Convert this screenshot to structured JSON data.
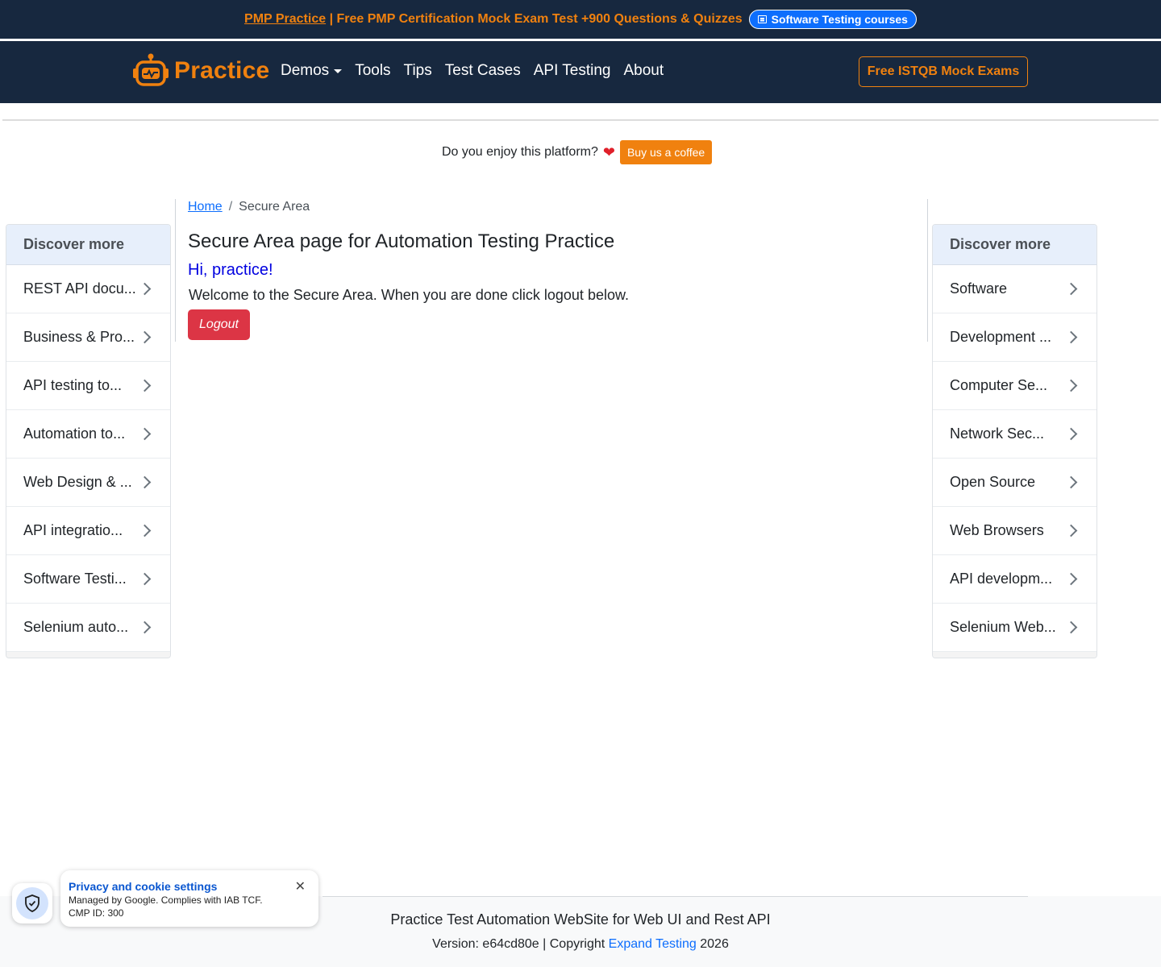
{
  "topbar": {
    "promo_link": "PMP Practice",
    "promo_text": " | Free PMP Certification Mock Exam Test +900 Questions & Quizzes",
    "pill_label": "Software Testing courses"
  },
  "navbar": {
    "brand": "Practice",
    "links": [
      "Demos",
      "Tools",
      "Tips",
      "Test Cases",
      "API Testing",
      "About"
    ],
    "cta": "Free ISTQB Mock Exams"
  },
  "coffee": {
    "question": "Do you enjoy this platform?",
    "button": "Buy us a coffee"
  },
  "breadcrumb": {
    "home": "Home",
    "current": "Secure Area"
  },
  "main": {
    "title": "Secure Area page for Automation Testing Practice",
    "greeting": "Hi, practice!",
    "welcome": "Welcome to the Secure Area. When you are done click logout below.",
    "logout_label": "Logout"
  },
  "left_sidebar": {
    "heading": "Discover more",
    "items": [
      "REST API docu...",
      "Business & Pro...",
      "API testing to...",
      "Automation to...",
      "Web Design & ...",
      "API integratio...",
      "Software Testi...",
      "Selenium auto..."
    ]
  },
  "right_sidebar": {
    "heading": "Discover more",
    "items": [
      "Software",
      "Development ...",
      "Computer Se...",
      "Network Sec...",
      "Open Source",
      "Web Browsers",
      "API developm...",
      "Selenium Web..."
    ]
  },
  "footer": {
    "title": "Practice Test Automation WebSite for Web UI and Rest API",
    "version_prefix": "Version: e64cd80e | Copyright ",
    "company": "Expand Testing",
    "year": " 2026"
  },
  "cookie": {
    "title": "Privacy and cookie settings",
    "line1": "Managed by Google. Complies with IAB TCF.",
    "line2": "CMP ID: 300"
  },
  "colors": {
    "navy": "#17283f",
    "orange": "#f0810f",
    "blue": "#0d6efd",
    "red": "#dc3545"
  }
}
